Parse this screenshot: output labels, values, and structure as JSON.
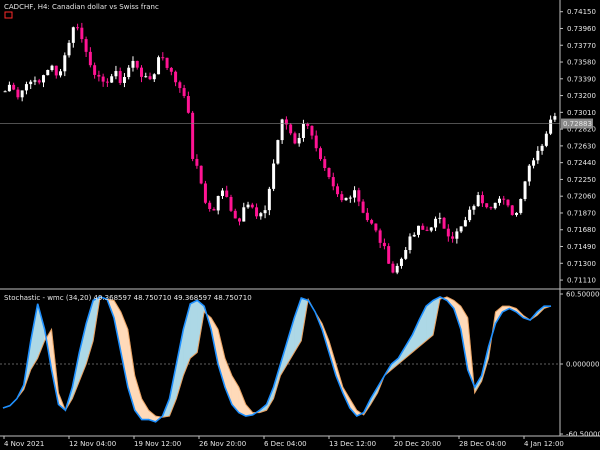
{
  "main_chart": {
    "title": "CADCHF, H4:  Canadian dollar vs Swiss franc",
    "current_price_label": "0.72883",
    "price_ticks": [
      "0.74150",
      "0.73960",
      "0.73770",
      "0.73580",
      "0.73390",
      "0.73200",
      "0.73010",
      "0.72820",
      "0.72630",
      "0.72440",
      "0.72250",
      "0.72060",
      "0.71870",
      "0.71680",
      "0.71490",
      "0.71300",
      "0.71110"
    ]
  },
  "indicator": {
    "title": "Stochastic - wmc  (34,20)  49.368597  48.750710  49.368597  48.750710",
    "ticks": [
      "60.500000",
      "0.000000",
      "-60.500000"
    ]
  },
  "time_axis": {
    "labels": [
      "4 Nov 2021",
      "12 Nov 04:00",
      "19 Nov 12:00",
      "26 Nov 20:00",
      "6 Dec 04:00",
      "13 Dec 12:00",
      "20 Dec 20:00",
      "28 Dec 04:00",
      "4 Jan 12:00"
    ]
  },
  "colors": {
    "bull_candle": "#ffffff",
    "bear_candle": "#ff1493",
    "stoch_line": "#1e90ff",
    "fill_up": "#add8e6",
    "fill_down": "#ffdab9",
    "grid": "#808080"
  },
  "chart_data": [
    {
      "type": "candlestick",
      "title": "CADCHF, H4:  Canadian dollar vs Swiss franc",
      "ylim": [
        0.7102,
        0.7426
      ],
      "x_labels": [
        "4 Nov 2021",
        "12 Nov 04:00",
        "19 Nov 12:00",
        "26 Nov 20:00",
        "6 Dec 04:00",
        "13 Dec 12:00",
        "20 Dec 20:00",
        "28 Dec 04:00",
        "4 Jan 12:00"
      ],
      "close_path_approx": [
        0.7325,
        0.7335,
        0.732,
        0.733,
        0.734,
        0.733,
        0.7345,
        0.7355,
        0.734,
        0.736,
        0.7385,
        0.7405,
        0.738,
        0.736,
        0.7345,
        0.733,
        0.734,
        0.7345,
        0.7335,
        0.735,
        0.736,
        0.7345,
        0.7335,
        0.7345,
        0.737,
        0.7355,
        0.734,
        0.733,
        0.732,
        0.725,
        0.723,
        0.72,
        0.7185,
        0.7205,
        0.7215,
        0.719,
        0.7175,
        0.72,
        0.7195,
        0.718,
        0.7185,
        0.722,
        0.7265,
        0.7295,
        0.728,
        0.7265,
        0.7285,
        0.729,
        0.726,
        0.724,
        0.7225,
        0.721,
        0.72,
        0.7205,
        0.7215,
        0.7195,
        0.718,
        0.717,
        0.7155,
        0.714,
        0.712,
        0.713,
        0.715,
        0.716,
        0.717,
        0.7165,
        0.7175,
        0.718,
        0.717,
        0.716,
        0.7165,
        0.7175,
        0.719,
        0.7205,
        0.72,
        0.7195,
        0.7205,
        0.72,
        0.719,
        0.7185,
        0.7215,
        0.724,
        0.7255,
        0.7265,
        0.7285,
        0.73
      ]
    },
    {
      "type": "area",
      "title": "Stochastic - wmc  (34,20)  49.368597  48.750710  49.368597  48.750710",
      "ylim": [
        -60.5,
        60.5
      ],
      "y_ticks": [
        60.5,
        0.0,
        -60.5
      ],
      "series": [
        {
          "name": "",
          "values": [
            -38,
            -36,
            -30,
            -18,
            20,
            52,
            30,
            -5,
            -35,
            -40,
            -20,
            10,
            35,
            55,
            58,
            56,
            40,
            10,
            -20,
            -40,
            -48,
            -48,
            -50,
            -45,
            -30,
            0,
            30,
            52,
            55,
            50,
            30,
            0,
            -20,
            -35,
            -42,
            -45,
            -44,
            -40,
            -35,
            -20,
            0,
            20,
            40,
            57,
            55,
            45,
            30,
            10,
            -10,
            -25,
            -38,
            -45,
            -42,
            -30,
            -20,
            -10,
            0,
            5,
            15,
            25,
            38,
            50,
            55,
            58,
            55,
            48,
            30,
            -5,
            -20,
            -10,
            15,
            35,
            45,
            48,
            45,
            40,
            38,
            45,
            50,
            50
          ]
        },
        {
          "name": "",
          "values": [
            -38,
            -36,
            -30,
            -22,
            -5,
            5,
            20,
            30,
            -25,
            -40,
            -30,
            -15,
            0,
            20,
            58,
            56,
            55,
            45,
            30,
            -10,
            -30,
            -40,
            -45,
            -46,
            -45,
            -30,
            -10,
            5,
            10,
            45,
            40,
            30,
            5,
            -10,
            -20,
            -35,
            -42,
            -42,
            -40,
            -30,
            -10,
            0,
            10,
            20,
            56,
            45,
            35,
            20,
            0,
            -20,
            -30,
            -40,
            -44,
            -35,
            -25,
            -10,
            -5,
            0,
            5,
            10,
            15,
            20,
            25,
            56,
            58,
            55,
            50,
            40,
            -25,
            -15,
            5,
            45,
            50,
            50,
            48,
            42,
            38,
            42,
            48,
            50
          ]
        }
      ]
    }
  ]
}
